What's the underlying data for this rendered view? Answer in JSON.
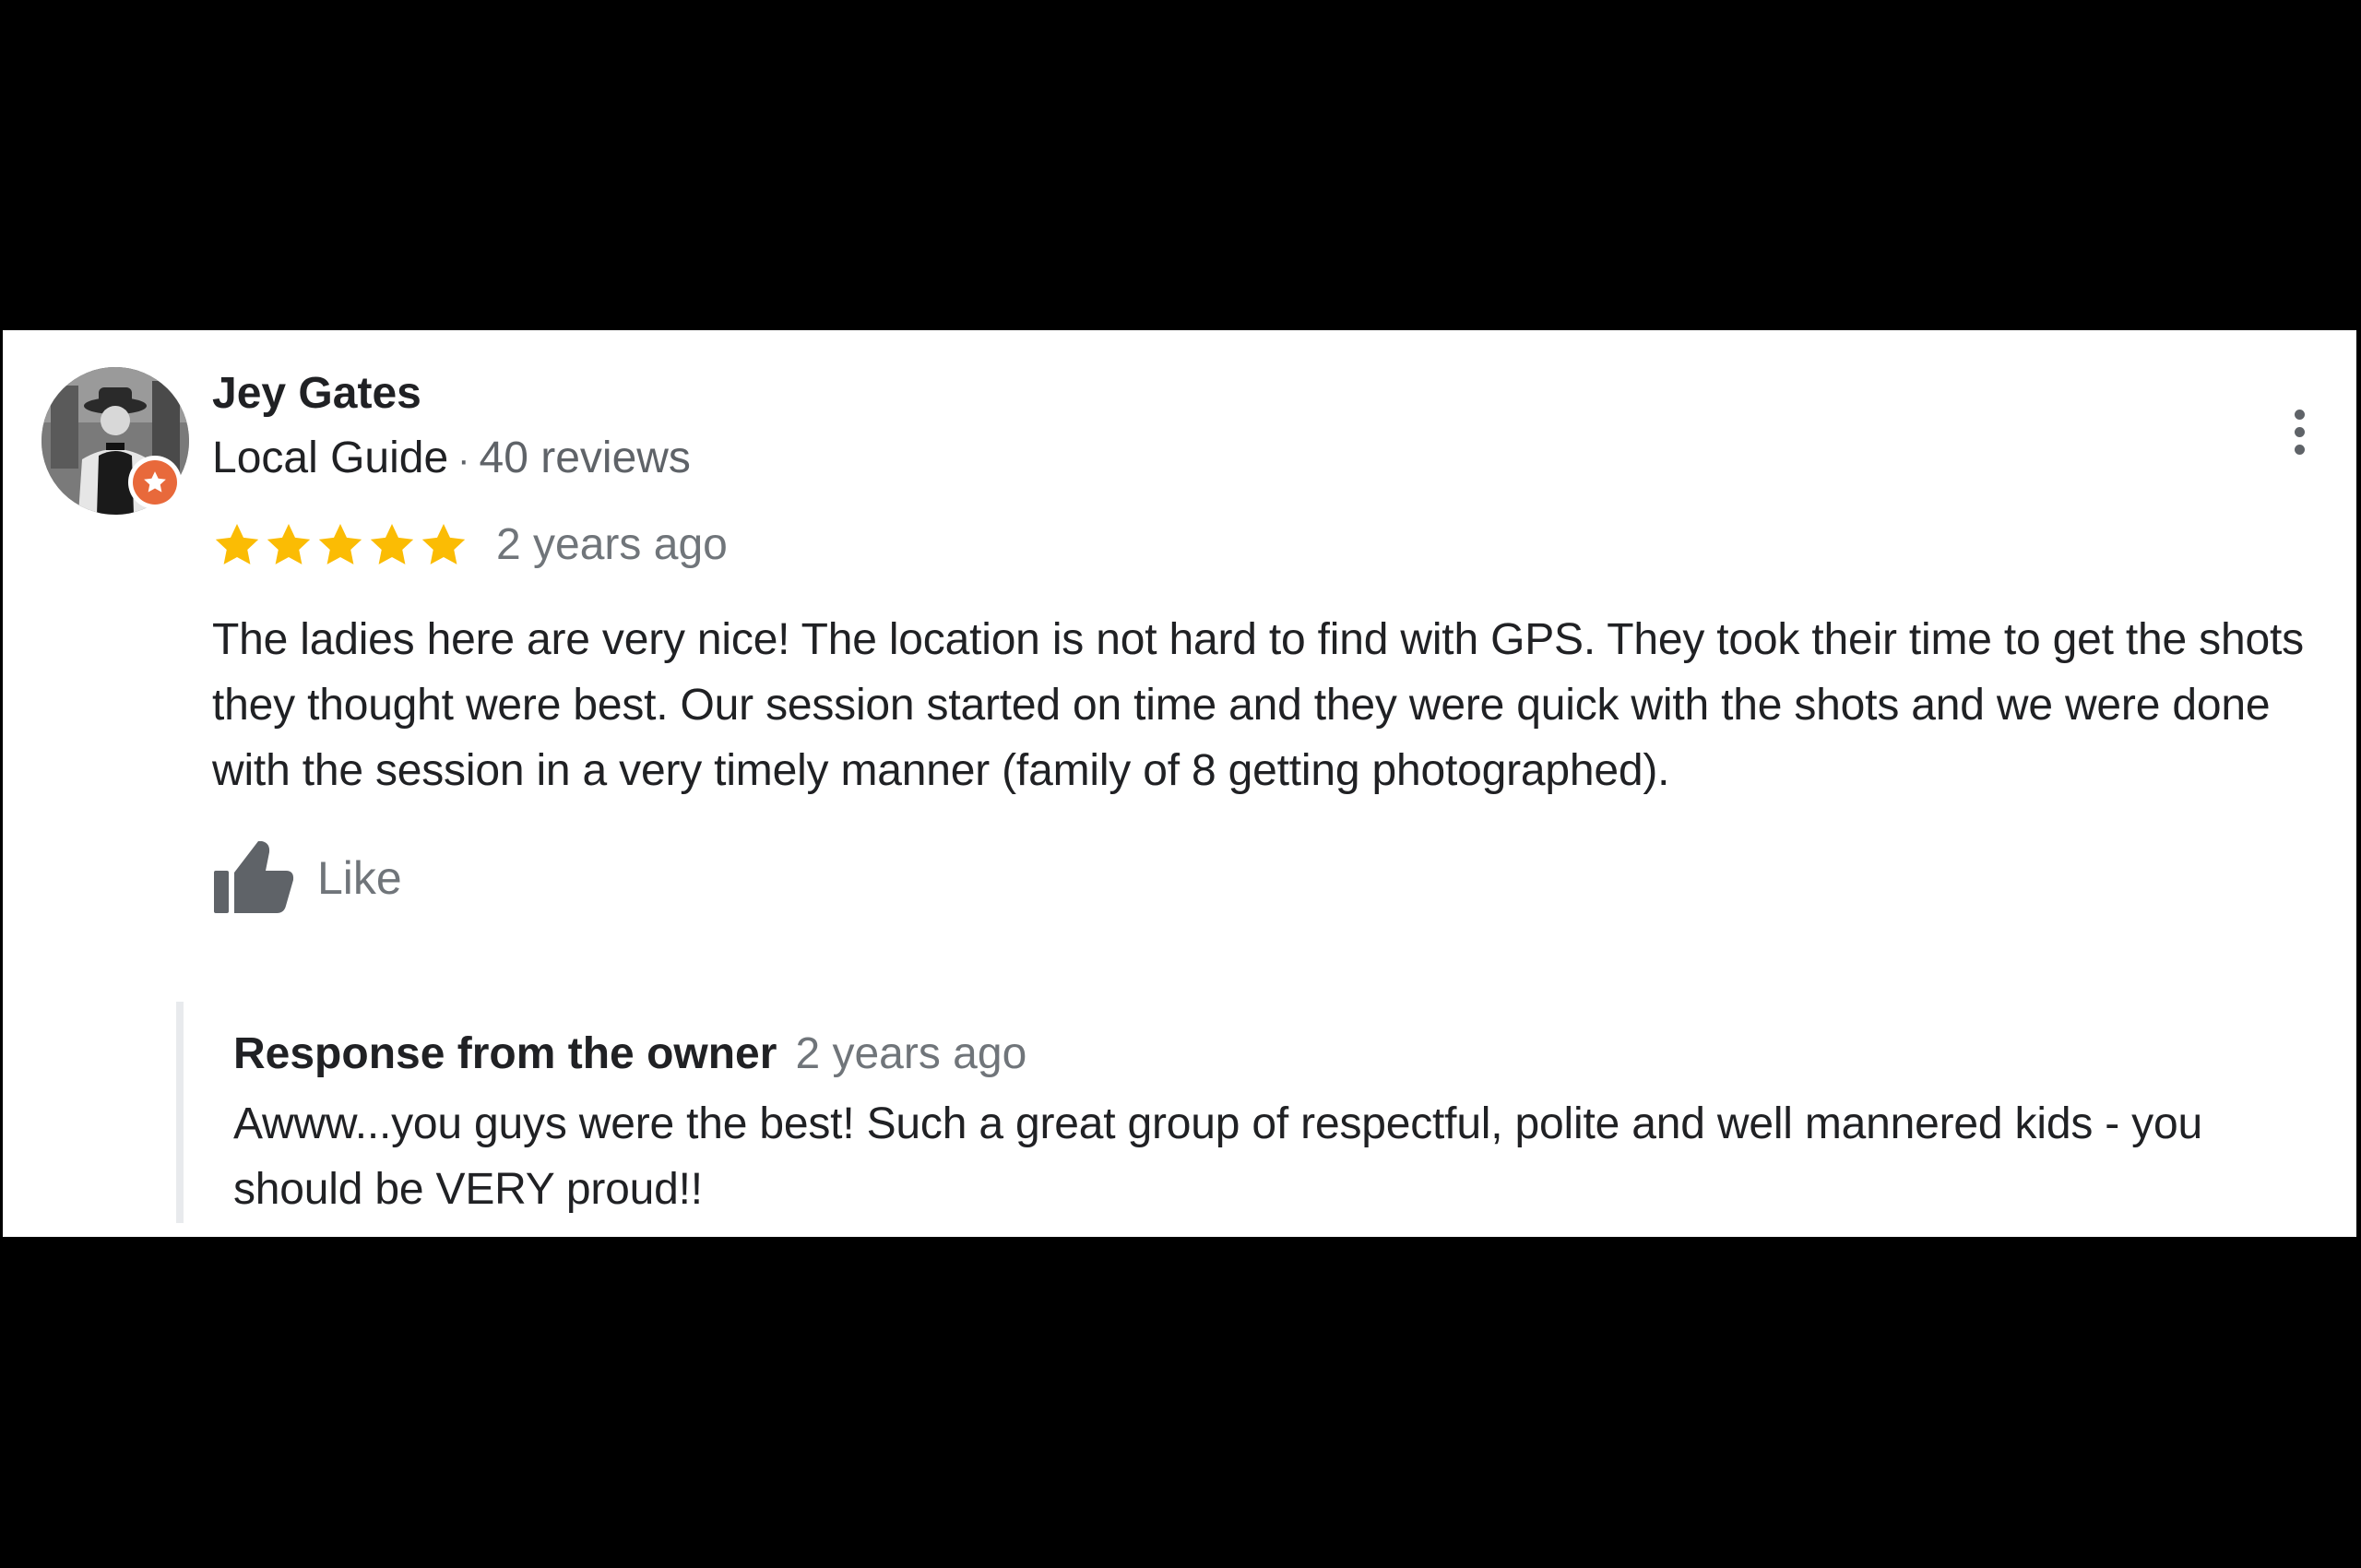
{
  "review": {
    "reviewer_name": "Jey Gates",
    "reviewer_badge": "Local Guide",
    "separator": "·",
    "review_count": "40 reviews",
    "rating": 5,
    "rating_max": 5,
    "time_ago": "2 years ago",
    "text": "The ladies here are very nice! The location is not hard to find with GPS. They took their time to get the shots they thought were best. Our session started on time and they were quick with the shots and we were done with the session in a very timely manner (family of 8 getting photographed).",
    "like_label": "Like",
    "icons": {
      "avatar": "avatar-photo",
      "badge": "local-guide-star-icon",
      "more": "more-vert-icon",
      "star": "star-icon",
      "like": "thumbs-up-icon"
    }
  },
  "owner_response": {
    "title": "Response from the owner",
    "time_ago": "2 years ago",
    "text": "Awww...you guys were the best! Such a great group of respectful, polite and well mannered kids - you should be VERY proud!!"
  },
  "colors": {
    "star": "#fbbc04",
    "badge": "#e8693b",
    "secondary_text": "#70757a",
    "primary_text": "#202124",
    "response_rule": "#e8eaed"
  }
}
